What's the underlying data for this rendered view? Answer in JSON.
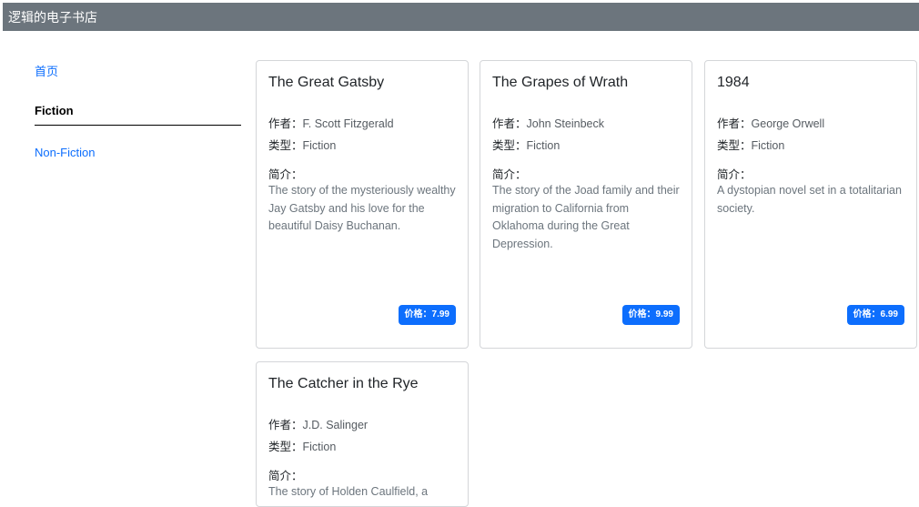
{
  "header": {
    "title": "逻辑的电子书店"
  },
  "sidebar": {
    "items": [
      {
        "label": "首页"
      },
      {
        "label": "Fiction"
      },
      {
        "label": "Non-Fiction"
      }
    ]
  },
  "labels": {
    "author": "作者：",
    "genre": "类型：",
    "description": "简介：",
    "price": "价格："
  },
  "books": [
    {
      "title": "The Great Gatsby",
      "author": "F. Scott Fitzgerald",
      "genre": "Fiction",
      "description": "The story of the mysteriously wealthy Jay Gatsby and his love for the beautiful Daisy Buchanan.",
      "price": "7.99"
    },
    {
      "title": "The Grapes of Wrath",
      "author": "John Steinbeck",
      "genre": "Fiction",
      "description": "The story of the Joad family and their migration to California from Oklahoma during the Great Depression.",
      "price": "9.99"
    },
    {
      "title": "1984",
      "author": "George Orwell",
      "genre": "Fiction",
      "description": "A dystopian novel set in a totalitarian society.",
      "price": "6.99"
    },
    {
      "title": "The Catcher in the Rye",
      "author": "J.D. Salinger",
      "genre": "Fiction",
      "description": "The story of Holden Caulfield, a"
    }
  ],
  "colors": {
    "header_bg": "#6c757d",
    "link": "#0d6efd",
    "price_badge": "#0d6efd"
  }
}
